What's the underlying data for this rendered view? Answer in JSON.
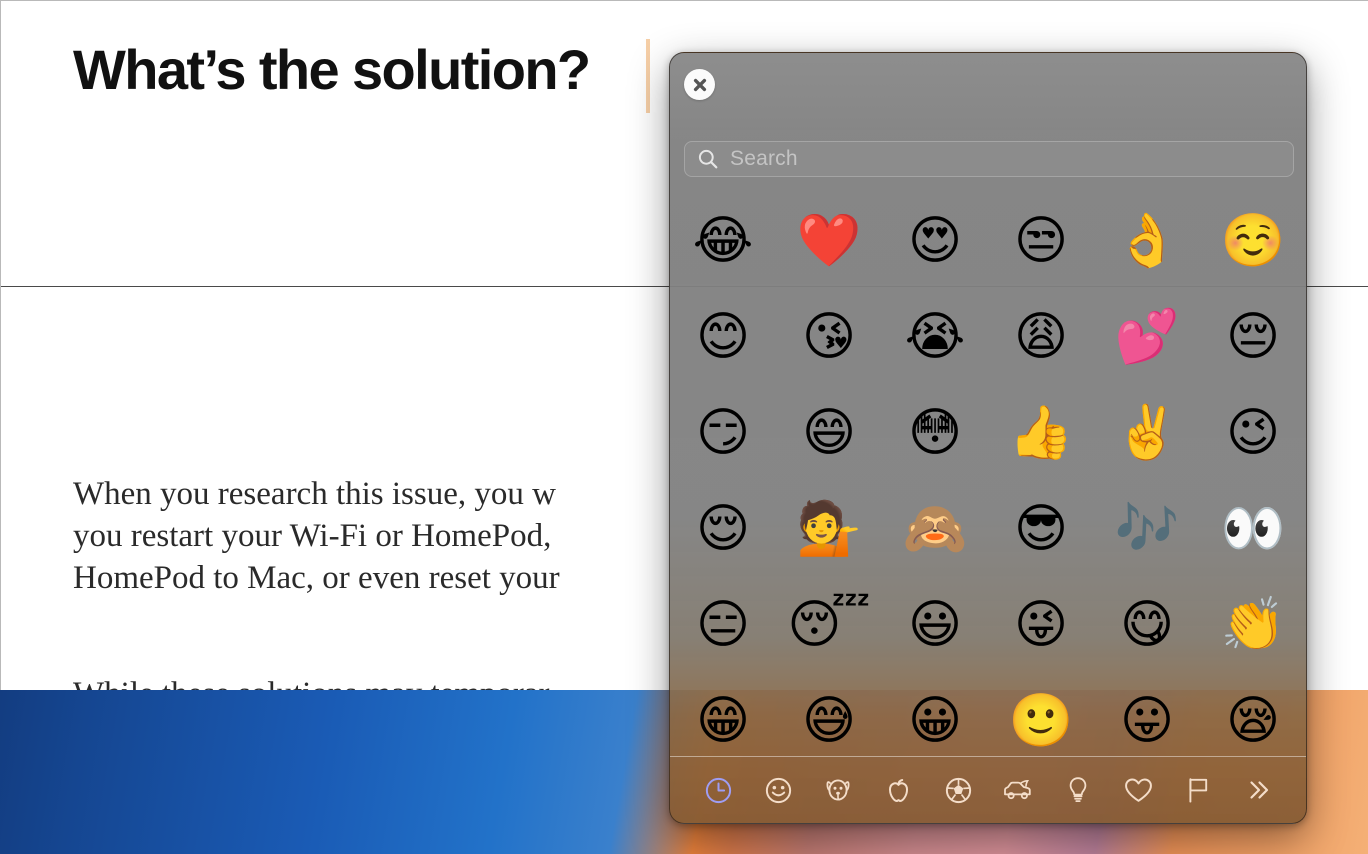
{
  "document": {
    "title": "What’s the solution?",
    "paragraph_1_lines": [
      "When you research this issue, you w",
      "you restart your Wi-Fi or HomePod,",
      "HomePod to Mac, or even reset your"
    ],
    "paragraph_2_lines": [
      "While these solutions may temporar"
    ]
  },
  "emoji_picker": {
    "close_label": "×",
    "close_icon": "close-icon",
    "search": {
      "icon": "search-icon",
      "placeholder": "Search",
      "value": ""
    },
    "grid": {
      "columns": 6,
      "rows": [
        [
          "😂",
          "❤️",
          "😍",
          "😒",
          "👌",
          "☺️"
        ],
        [
          "😊",
          "😘",
          "😭",
          "😩",
          "💕",
          "😔"
        ],
        [
          "😏",
          "😄",
          "😳",
          "👍",
          "✌️",
          "😉"
        ],
        [
          "😌",
          "💁",
          "🙈",
          "😎",
          "🎶",
          "👀"
        ],
        [
          "😑",
          "😴",
          "😃",
          "😜",
          "😋",
          "👏"
        ],
        [
          "😁",
          "😅",
          "😀",
          "🙂",
          "😛",
          "😪"
        ]
      ],
      "row_names": [
        "emoji-row-1",
        "emoji-row-2",
        "emoji-row-3",
        "emoji-row-4",
        "emoji-row-5",
        "emoji-row-6"
      ]
    },
    "categories": [
      {
        "name": "category-recents",
        "icon": "clock-icon",
        "label": "Frequently Used",
        "selected": true
      },
      {
        "name": "category-smileys",
        "icon": "smiley-icon",
        "label": "Smileys & People",
        "selected": false
      },
      {
        "name": "category-animals",
        "icon": "dog-icon",
        "label": "Animals & Nature",
        "selected": false
      },
      {
        "name": "category-food",
        "icon": "apple-icon",
        "label": "Food & Drink",
        "selected": false
      },
      {
        "name": "category-activity",
        "icon": "soccer-icon",
        "label": "Activity",
        "selected": false
      },
      {
        "name": "category-travel",
        "icon": "car-icon",
        "label": "Travel & Places",
        "selected": false
      },
      {
        "name": "category-objects",
        "icon": "lightbulb-icon",
        "label": "Objects",
        "selected": false
      },
      {
        "name": "category-symbols",
        "icon": "heart-icon",
        "label": "Symbols",
        "selected": false
      },
      {
        "name": "category-flags",
        "icon": "flag-icon",
        "label": "Flags",
        "selected": false
      },
      {
        "name": "category-more",
        "icon": "chevron-double-right-icon",
        "label": "»",
        "selected": false
      }
    ]
  },
  "colors": {
    "panel_gray": "#808080",
    "panel_warm": "#8a6038",
    "selected_accent": "#9f9df2",
    "category_icon": "#f4ddc9",
    "caret": "#f6cfa7",
    "document_text": "#2a2a2a",
    "title_text": "#111111"
  }
}
